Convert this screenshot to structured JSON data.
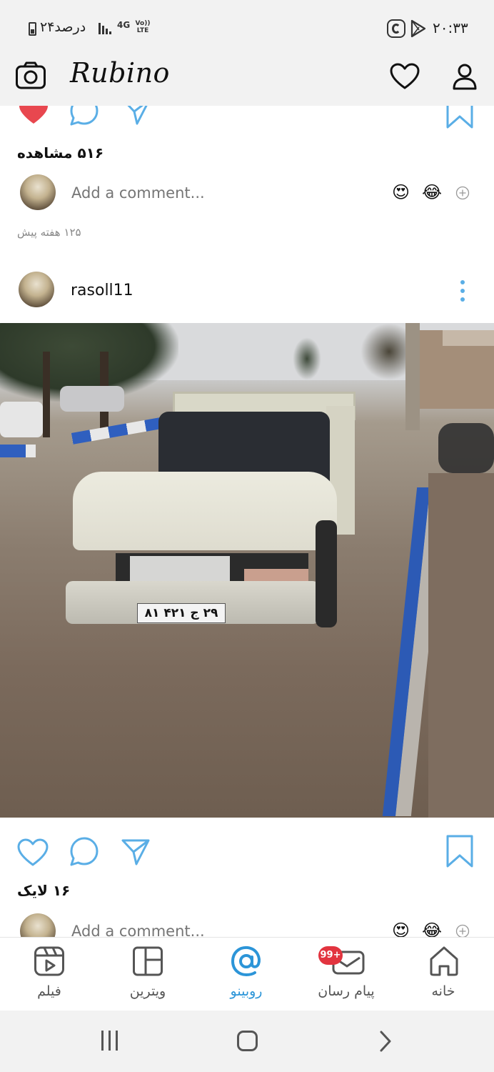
{
  "status_bar": {
    "battery_text": "۲۴درصد",
    "network": "4G",
    "volte": "Vo)) LTE",
    "time": "۲۰:۳۳"
  },
  "app": {
    "title": "Rubino",
    "icons": [
      "camera-icon",
      "heart-icon",
      "profile-icon"
    ]
  },
  "post_previous": {
    "views": "۵۱۶ مشاهده",
    "comment_placeholder": "Add a comment...",
    "emojis": [
      "😍",
      "😂"
    ],
    "time_ago": "۱۲۵ هفته پیش"
  },
  "post_current": {
    "username": "rasoll11",
    "plate_text": "۲۹ ج ۴۲۱ ۸۱",
    "likes": "۱۶ لایک",
    "comment_placeholder": "Add a comment...",
    "emojis": [
      "😍",
      "😂"
    ]
  },
  "bottom_nav": {
    "items": [
      {
        "label": "فیلم",
        "icon": "film-icon"
      },
      {
        "label": "ویترین",
        "icon": "showcase-grid-icon"
      },
      {
        "label": "روبینو",
        "icon": "at-sign-icon",
        "active": true
      },
      {
        "label": "پیام رسان",
        "icon": "messenger-icon",
        "badge": "99+"
      },
      {
        "label": "خانه",
        "icon": "home-icon"
      }
    ],
    "active_color": "#2c95d8",
    "badge_color": "#e2343f"
  },
  "colors": {
    "accent": "#5aaee6",
    "like_red": "#e8474f"
  }
}
